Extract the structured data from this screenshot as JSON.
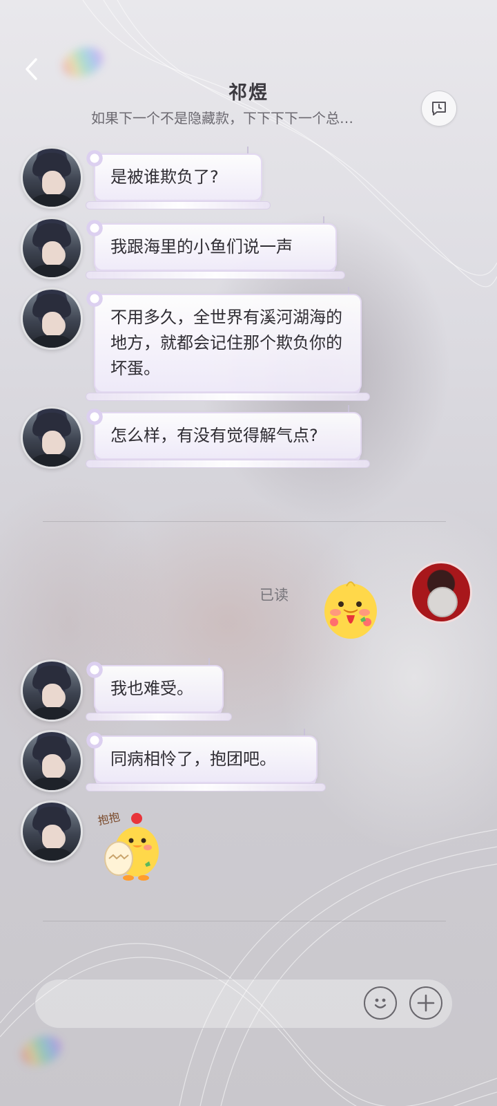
{
  "header": {
    "title": "祁煜",
    "subtitle": "如果下一个不是隐藏款，下下下下一个总…",
    "back_icon": "chevron-left-icon",
    "history_icon": "chat-history-icon"
  },
  "messages": [
    {
      "text": "是被谁欺负了?"
    },
    {
      "text": "我跟海里的小鱼们说一声"
    },
    {
      "text": "不用多久，全世界有溪河湖海的地方，就都会记住那个欺负你的坏蛋。"
    },
    {
      "text": "怎么样，有没有觉得解气点?"
    },
    {
      "text": "我也难受。"
    },
    {
      "text": "同病相怜了，抱团吧。"
    }
  ],
  "read_status": "已读",
  "sticker_caption": "抱抱",
  "input": {
    "placeholder": "",
    "emoji_icon": "smiley-icon",
    "add_icon": "plus-icon"
  },
  "colors": {
    "bubble_bg": "#f3effa",
    "bubble_border": "#e1d7f0",
    "text": "#2f2d33",
    "user_avatar_bg": "#a8171b",
    "duck_yellow": "#ffd84a"
  }
}
